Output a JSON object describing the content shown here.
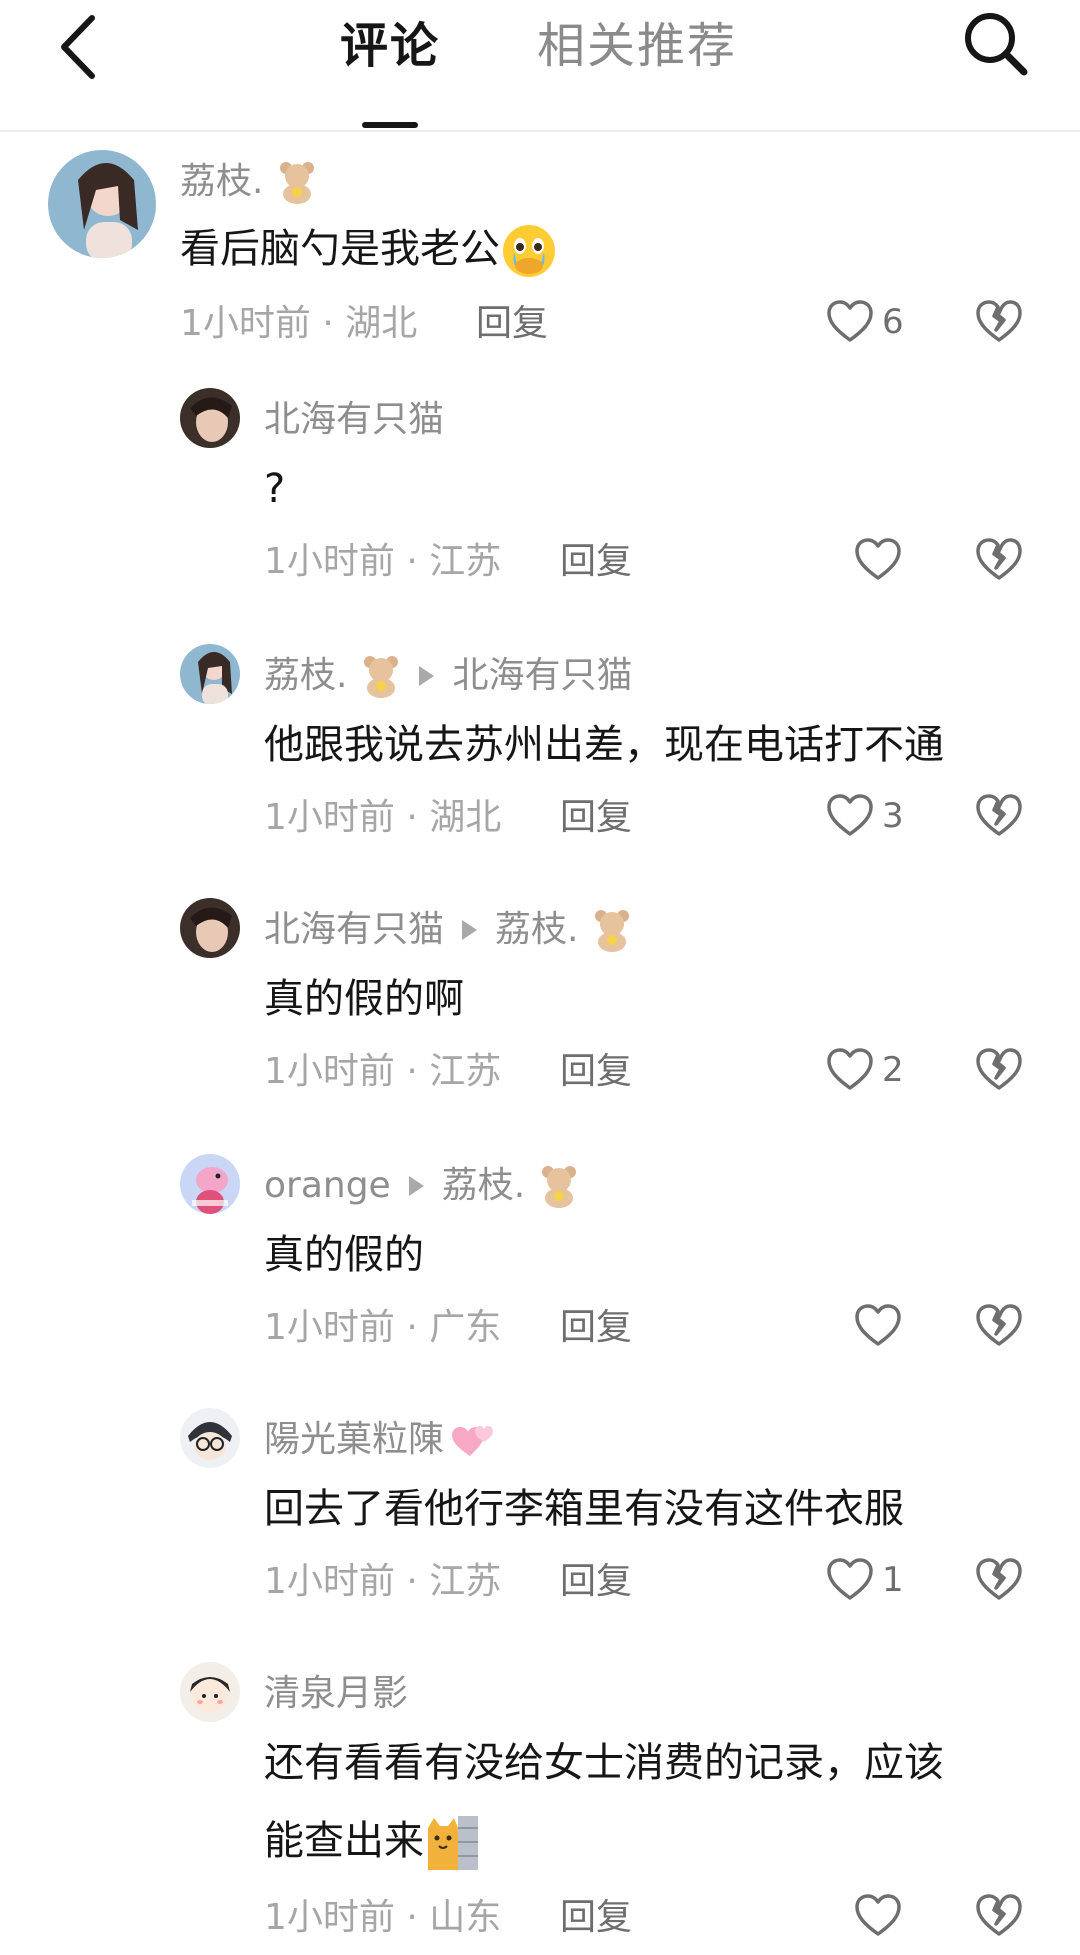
{
  "header": {
    "tabs": [
      {
        "label": "评论",
        "active": true
      },
      {
        "label": "相关推荐",
        "active": false
      }
    ]
  },
  "icons": [
    "back-arrow-icon",
    "search-icon",
    "heart-icon",
    "broken-heart-icon",
    "bear-emoji-icon",
    "crying-emoji-icon",
    "sparkling-hearts-emoji-icon",
    "cat-wall-emoji-icon"
  ],
  "comments": [
    {
      "user": "荔枝.",
      "text": "看后脑勺是我老公",
      "time": "1小时前 · 湖北",
      "reply": "回复",
      "likes": "6"
    },
    {
      "user": "北海有只猫",
      "text": "?",
      "time": "1小时前 · 江苏",
      "reply": "回复",
      "likes": ""
    },
    {
      "user": "荔枝.",
      "reply_to": "北海有只猫",
      "text": "他跟我说去苏州出差，现在电话打不通",
      "time": "1小时前 · 湖北",
      "reply": "回复",
      "likes": "3"
    },
    {
      "user": "北海有只猫",
      "reply_to": "荔枝.",
      "text": "真的假的啊",
      "time": "1小时前 · 江苏",
      "reply": "回复",
      "likes": "2"
    },
    {
      "user": "orange",
      "reply_to": "荔枝.",
      "text": "真的假的",
      "time": "1小时前 · 广东",
      "reply": "回复",
      "likes": ""
    },
    {
      "user": "陽光菓粒陳",
      "text": "回去了看他行李箱里有没有这件衣服",
      "time": "1小时前 · 江苏",
      "reply": "回复",
      "likes": "1"
    },
    {
      "user": "清泉月影",
      "text": "还有看看有没给女士消费的记录，应该",
      "text2": "能查出来",
      "time": "1小时前 · 山东",
      "reply": "回复",
      "likes": ""
    }
  ]
}
